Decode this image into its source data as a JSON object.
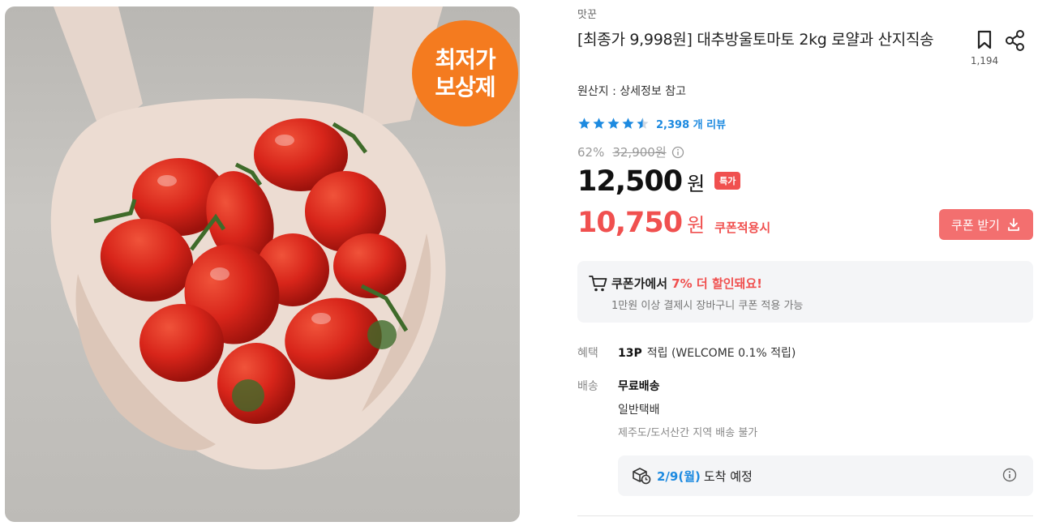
{
  "image": {
    "badge_line1": "최저가",
    "badge_line2": "보상제",
    "badge_color": "#f47b1f"
  },
  "product": {
    "brand": "맛꾼",
    "title": "[최종가 9,998원] 대추방울토마토 2kg 로얄과 산지직송",
    "origin": "원산지 : 상세정보 참고",
    "bookmark_count": "1,194",
    "bookmark_icon": "bookmark-icon",
    "share_icon": "share-icon"
  },
  "rating": {
    "value": 4.5,
    "review_count_label": "2,398 개 리뷰",
    "star_color": "#1d8ae0"
  },
  "price": {
    "discount_rate": "62%",
    "original_price": "32,900원",
    "sale_price": "12,500",
    "currency": "원",
    "special_badge": "특가",
    "coupon_price": "10,750",
    "coupon_currency": "원",
    "coupon_applied_label": "쿠폰적용시",
    "coupon_button_label": "쿠폰 받기",
    "accent_color": "#f0504f"
  },
  "coupon_box": {
    "text_prefix": "쿠폰가에서 ",
    "text_highlight": "7% 더 할인돼요!",
    "subtext": "1만원 이상 결제시 장바구니 쿠폰 적용 가능"
  },
  "benefit": {
    "label": "혜택",
    "points": "13P",
    "description": "적립 (WELCOME 0.1% 적립)"
  },
  "shipping": {
    "label": "배송",
    "fee": "무료배송",
    "type": "일반택배",
    "note": "제주도/도서산간 지역 배송 불가",
    "arrival_date": "2/9(월)",
    "arrival_text": "도착 예정"
  }
}
